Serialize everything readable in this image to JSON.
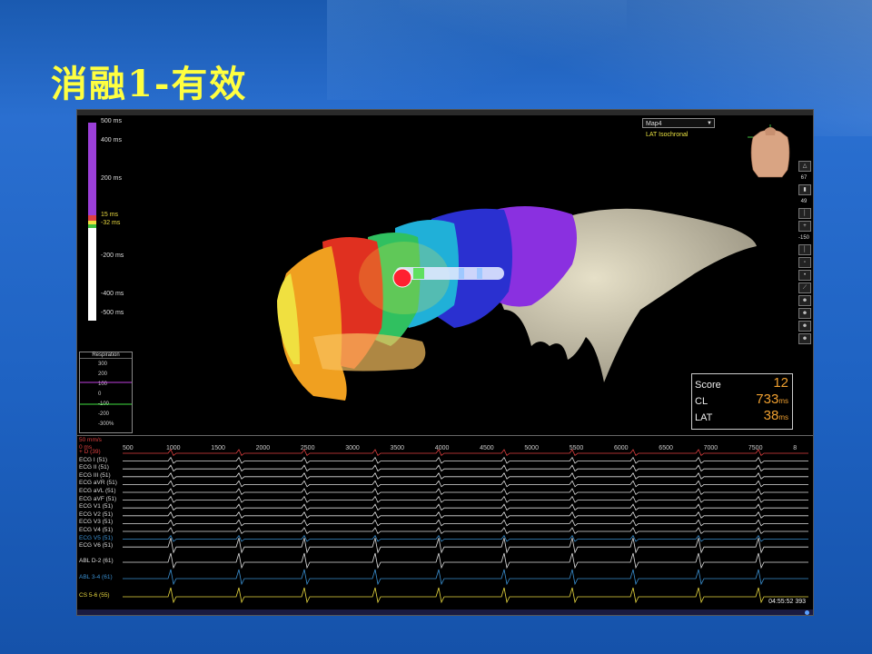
{
  "slide": {
    "title": "消融1-有效"
  },
  "lat_scale": {
    "labels": [
      "500 ms",
      "400 ms",
      "200 ms",
      "15 ms",
      "-32 ms",
      "-200 ms",
      "-400 ms",
      "-500 ms"
    ]
  },
  "map": {
    "name": "Map4",
    "type": "LAT Isochronal"
  },
  "respiration": {
    "title": "Respiration",
    "values": [
      "300",
      "200",
      "100",
      "0",
      "-100",
      "-200",
      "-300%"
    ]
  },
  "score_panel": {
    "score_label": "Score",
    "score_value": "12",
    "cl_label": "CL",
    "cl_value": "733",
    "cl_unit": "ms",
    "lat_label": "LAT",
    "lat_value": "38",
    "lat_unit": "ms"
  },
  "toolbar": {
    "zoom_value": "67",
    "val_49": "49",
    "val_150": "-150"
  },
  "ecg": {
    "corner_top": "50 mm/s",
    "corner_zero": "0 ms",
    "time_ticks": [
      "1000",
      "1500",
      "2000",
      "2500",
      "3000",
      "3500",
      "4000",
      "4500",
      "5000",
      "5500",
      "6000",
      "6500",
      "7000",
      "7500",
      "8"
    ],
    "tick_500": "500",
    "channels": [
      {
        "label": "+ D (39)",
        "color": "#e04040"
      },
      {
        "label": "ECG I (51)",
        "color": "#dddddd"
      },
      {
        "label": "ECG II (51)",
        "color": "#dddddd"
      },
      {
        "label": "ECG III (51)",
        "color": "#dddddd"
      },
      {
        "label": "ECG aVR (51)",
        "color": "#dddddd"
      },
      {
        "label": "ECG aVL (51)",
        "color": "#dddddd"
      },
      {
        "label": "ECG aVF (51)",
        "color": "#dddddd"
      },
      {
        "label": "ECG V1 (51)",
        "color": "#dddddd"
      },
      {
        "label": "ECG V2 (51)",
        "color": "#dddddd"
      },
      {
        "label": "ECG V3 (51)",
        "color": "#dddddd"
      },
      {
        "label": "ECG V4 (51)",
        "color": "#dddddd"
      },
      {
        "label": "ECG V5 (51)",
        "color": "#3a8fd0"
      },
      {
        "label": "ECG V6 (51)",
        "color": "#dddddd"
      },
      {
        "label": "ABL  D-2 (61)",
        "color": "#dddddd"
      },
      {
        "label": "ABL  3-4 (61)",
        "color": "#3a8fd0"
      },
      {
        "label": "CS  5-6 (55)",
        "color": "#e8d840"
      }
    ],
    "clock": "04:55:52 393"
  }
}
